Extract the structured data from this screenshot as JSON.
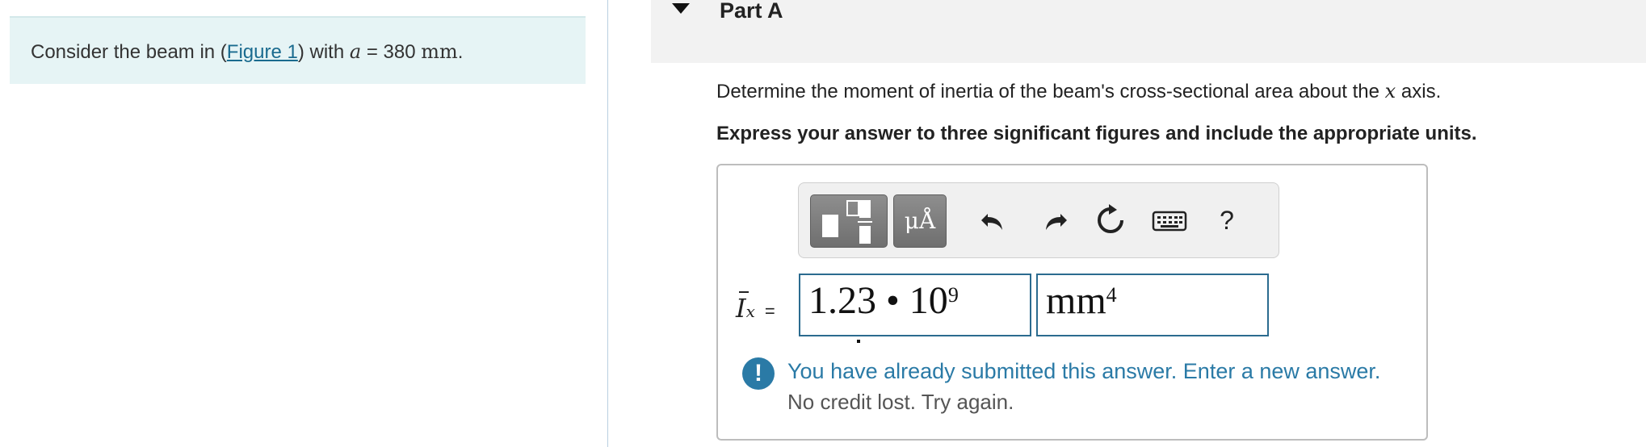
{
  "problem": {
    "prefix": "Consider the beam in (",
    "figure_link": "Figure 1",
    "mid": ") with ",
    "var": "a",
    "equals": " = 380 ",
    "unit": "mm",
    "suffix": "."
  },
  "part": {
    "title": "Part A"
  },
  "question": {
    "text_before": "Determine the moment of inertia of the beam's cross-sectional area about the ",
    "axis_var": "x",
    "text_after": " axis."
  },
  "instruction": "Express your answer to three significant figures and include the appropriate units.",
  "toolbar": {
    "units_label": "μÅ",
    "undo_icon": "undo-icon",
    "redo_icon": "redo-icon",
    "reset_icon": "reset-icon",
    "keyboard_icon": "keyboard-icon",
    "help_label": "?"
  },
  "answer": {
    "lhs_symbol": "I",
    "lhs_subscript": "x",
    "lhs_equals": "=",
    "value_mantissa": "1.23 • 10",
    "value_exponent": "9",
    "unit_base": "mm",
    "unit_exponent": "4"
  },
  "feedback": {
    "icon": "!",
    "message": "You have already submitted this answer. Enter a new answer.",
    "submessage": "No credit lost. Try again."
  },
  "colors": {
    "accent": "#2a7aa6",
    "problem_bg": "#e6f4f5",
    "field_border": "#2b6b8f"
  }
}
